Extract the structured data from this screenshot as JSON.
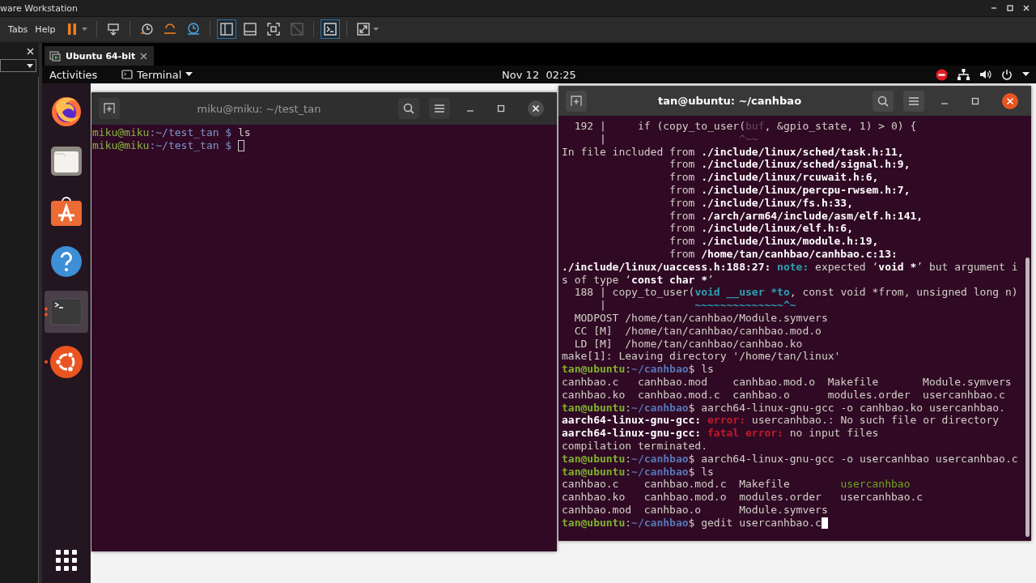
{
  "app_window": {
    "title": "ware Workstation"
  },
  "menu": [
    "Tabs",
    "Help"
  ],
  "toolbar": [
    {
      "kind": "pause",
      "selected": false,
      "disabled": false,
      "caret": true
    },
    {
      "kind": "send-keys",
      "selected": false,
      "disabled": false,
      "caret": false
    },
    {
      "kind": "snapshot",
      "selected": false,
      "disabled": false,
      "caret": false
    },
    {
      "kind": "revert",
      "selected": false,
      "disabled": false,
      "caret": false
    },
    {
      "kind": "manage-snapshots",
      "selected": false,
      "disabled": false,
      "caret": false
    },
    {
      "kind": "sidebar",
      "selected": true,
      "disabled": false,
      "caret": false
    },
    {
      "kind": "thumbnails",
      "selected": false,
      "disabled": false,
      "caret": false
    },
    {
      "kind": "fullscreen",
      "selected": false,
      "disabled": false,
      "caret": false
    },
    {
      "kind": "unity",
      "selected": false,
      "disabled": true,
      "caret": false
    },
    {
      "kind": "console",
      "selected": true,
      "disabled": false,
      "caret": false
    },
    {
      "kind": "stretch",
      "selected": false,
      "disabled": false,
      "caret": true
    }
  ],
  "vm_tab": {
    "label": "Ubuntu 64-bit",
    "selected": true
  },
  "top_bar": {
    "activities": "Activities",
    "app_menu": "Terminal",
    "clock": "Nov 12  02:25"
  },
  "dock": [
    {
      "kind": "firefox",
      "selected": false,
      "running": false
    },
    {
      "kind": "files",
      "selected": false,
      "running": false
    },
    {
      "kind": "software",
      "selected": false,
      "running": false
    },
    {
      "kind": "help",
      "selected": false,
      "running": false
    },
    {
      "kind": "terminal",
      "selected": true,
      "running": true,
      "multiple_windows": true
    },
    {
      "kind": "ubuntu",
      "selected": false,
      "running": true,
      "multiple_windows": false
    },
    {
      "kind": "app-grid",
      "selected": false,
      "running": false
    }
  ],
  "terminals": [
    {
      "title": "miku@miku: ~/test_tan",
      "focused": false,
      "lines": [
        {
          "cursor": false,
          "segments": [
            {
              "text": "miku@miku",
              "kind": "user"
            },
            {
              "text": ":~/test_tan $ ",
              "kind": "path"
            },
            {
              "text": "ls",
              "kind": "plain"
            }
          ]
        },
        {
          "cursor": true,
          "segments": [
            {
              "text": "miku@miku",
              "kind": "user"
            },
            {
              "text": ":~/test_tan $ ",
              "kind": "path"
            }
          ]
        }
      ]
    },
    {
      "title": "tan@ubuntu: ~/canhbao",
      "focused": true,
      "lines": [
        {
          "cursor": false,
          "segments": [
            {
              "text": "  192 |     if (copy_to_user(",
              "kind": "plain"
            },
            {
              "text": "buf",
              "kind": "dim"
            },
            {
              "text": ", &gpio_state, 1) > 0) {",
              "kind": "plain"
            }
          ]
        },
        {
          "cursor": false,
          "segments": [
            {
              "text": "      |                     ",
              "kind": "plain"
            },
            {
              "text": "^~~",
              "kind": "dim"
            }
          ]
        },
        {
          "cursor": false,
          "segments": [
            {
              "text": "In file included from ",
              "kind": "plain"
            },
            {
              "text": "./include/linux/sched/task.h:11,",
              "kind": "bold"
            }
          ]
        },
        {
          "cursor": false,
          "segments": [
            {
              "text": "                 from ",
              "kind": "plain"
            },
            {
              "text": "./include/linux/sched/signal.h:9,",
              "kind": "bold"
            }
          ]
        },
        {
          "cursor": false,
          "segments": [
            {
              "text": "                 from ",
              "kind": "plain"
            },
            {
              "text": "./include/linux/rcuwait.h:6,",
              "kind": "bold"
            }
          ]
        },
        {
          "cursor": false,
          "segments": [
            {
              "text": "                 from ",
              "kind": "plain"
            },
            {
              "text": "./include/linux/percpu-rwsem.h:7,",
              "kind": "bold"
            }
          ]
        },
        {
          "cursor": false,
          "segments": [
            {
              "text": "                 from ",
              "kind": "plain"
            },
            {
              "text": "./include/linux/fs.h:33,",
              "kind": "bold"
            }
          ]
        },
        {
          "cursor": false,
          "segments": [
            {
              "text": "                 from ",
              "kind": "plain"
            },
            {
              "text": "./arch/arm64/include/asm/elf.h:141,",
              "kind": "bold"
            }
          ]
        },
        {
          "cursor": false,
          "segments": [
            {
              "text": "                 from ",
              "kind": "plain"
            },
            {
              "text": "./include/linux/elf.h:6,",
              "kind": "bold"
            }
          ]
        },
        {
          "cursor": false,
          "segments": [
            {
              "text": "                 from ",
              "kind": "plain"
            },
            {
              "text": "./include/linux/module.h:19,",
              "kind": "bold"
            }
          ]
        },
        {
          "cursor": false,
          "segments": [
            {
              "text": "                 from ",
              "kind": "plain"
            },
            {
              "text": "/home/tan/canhbao/canhbao.c:13:",
              "kind": "bold"
            }
          ]
        },
        {
          "cursor": false,
          "segments": [
            {
              "text": "./include/linux/uaccess.h:188:27: ",
              "kind": "bold"
            },
            {
              "text": "note:",
              "kind": "note"
            },
            {
              "text": " expected ‘",
              "kind": "plain"
            },
            {
              "text": "void *",
              "kind": "bold"
            },
            {
              "text": "’ but argument i",
              "kind": "plain"
            }
          ]
        },
        {
          "cursor": false,
          "segments": [
            {
              "text": "s of type ‘",
              "kind": "plain"
            },
            {
              "text": "const char *",
              "kind": "bold"
            },
            {
              "text": "’",
              "kind": "plain"
            }
          ]
        },
        {
          "cursor": false,
          "segments": [
            {
              "text": "  188 | copy_to_user(",
              "kind": "plain"
            },
            {
              "text": "void __user *to",
              "kind": "note"
            },
            {
              "text": ", const void *from, unsigned long n)",
              "kind": "plain"
            }
          ]
        },
        {
          "cursor": false,
          "segments": [
            {
              "text": "      |              ",
              "kind": "plain"
            },
            {
              "text": "~~~~~~~~~~~~~~^~",
              "kind": "note"
            }
          ]
        },
        {
          "cursor": false,
          "segments": [
            {
              "text": "  MODPOST /home/tan/canhbao/Module.symvers",
              "kind": "plain"
            }
          ]
        },
        {
          "cursor": false,
          "segments": [
            {
              "text": "  CC [M]  /home/tan/canhbao/canhbao.mod.o",
              "kind": "plain"
            }
          ]
        },
        {
          "cursor": false,
          "segments": [
            {
              "text": "  LD [M]  /home/tan/canhbao/canhbao.ko",
              "kind": "plain"
            }
          ]
        },
        {
          "cursor": false,
          "segments": [
            {
              "text": "make[1]: Leaving directory '/home/tan/linux'",
              "kind": "plain"
            }
          ]
        },
        {
          "cursor": false,
          "segments": [
            {
              "text": "tan@ubuntu",
              "kind": "user"
            },
            {
              "text": ":",
              "kind": "plain"
            },
            {
              "text": "~/canhbao",
              "kind": "path"
            },
            {
              "text": "$ ls",
              "kind": "plain"
            }
          ]
        },
        {
          "cursor": false,
          "segments": [
            {
              "text": "canhbao.c   canhbao.mod    canhbao.mod.o  Makefile       Module.symvers",
              "kind": "plain"
            }
          ]
        },
        {
          "cursor": false,
          "segments": [
            {
              "text": "canhbao.ko  canhbao.mod.c  canhbao.o      modules.order  usercanhbao.c",
              "kind": "plain"
            }
          ]
        },
        {
          "cursor": false,
          "segments": [
            {
              "text": "tan@ubuntu",
              "kind": "user"
            },
            {
              "text": ":",
              "kind": "plain"
            },
            {
              "text": "~/canhbao",
              "kind": "path"
            },
            {
              "text": "$ aarch64-linux-gnu-gcc -o canhbao.ko usercanhbao.",
              "kind": "plain"
            }
          ]
        },
        {
          "cursor": false,
          "segments": [
            {
              "text": "aarch64-linux-gnu-gcc: ",
              "kind": "bold"
            },
            {
              "text": "error:",
              "kind": "error"
            },
            {
              "text": " usercanhbao.: No such file or directory",
              "kind": "plain"
            }
          ]
        },
        {
          "cursor": false,
          "segments": [
            {
              "text": "aarch64-linux-gnu-gcc: ",
              "kind": "bold"
            },
            {
              "text": "fatal error:",
              "kind": "error"
            },
            {
              "text": " no input files",
              "kind": "plain"
            }
          ]
        },
        {
          "cursor": false,
          "segments": [
            {
              "text": "compilation terminated.",
              "kind": "plain"
            }
          ]
        },
        {
          "cursor": false,
          "segments": [
            {
              "text": "tan@ubuntu",
              "kind": "user"
            },
            {
              "text": ":",
              "kind": "plain"
            },
            {
              "text": "~/canhbao",
              "kind": "path"
            },
            {
              "text": "$ aarch64-linux-gnu-gcc -o usercanhbao usercanhbao.c",
              "kind": "plain"
            }
          ]
        },
        {
          "cursor": false,
          "segments": [
            {
              "text": "tan@ubuntu",
              "kind": "user"
            },
            {
              "text": ":",
              "kind": "plain"
            },
            {
              "text": "~/canhbao",
              "kind": "path"
            },
            {
              "text": "$ ls",
              "kind": "plain"
            }
          ]
        },
        {
          "cursor": false,
          "segments": [
            {
              "text": "canhbao.c    canhbao.mod.c  Makefile        ",
              "kind": "plain"
            },
            {
              "text": "usercanhbao",
              "kind": "exec"
            }
          ]
        },
        {
          "cursor": false,
          "segments": [
            {
              "text": "canhbao.ko   canhbao.mod.o  modules.order   usercanhbao.c",
              "kind": "plain"
            }
          ]
        },
        {
          "cursor": false,
          "segments": [
            {
              "text": "canhbao.mod  canhbao.o      Module.symvers",
              "kind": "plain"
            }
          ]
        },
        {
          "cursor": true,
          "segments": [
            {
              "text": "tan@ubuntu",
              "kind": "user"
            },
            {
              "text": ":",
              "kind": "plain"
            },
            {
              "text": "~/canhbao",
              "kind": "path"
            },
            {
              "text": "$ gedit usercanhbao.c",
              "kind": "plain"
            }
          ]
        }
      ]
    }
  ]
}
